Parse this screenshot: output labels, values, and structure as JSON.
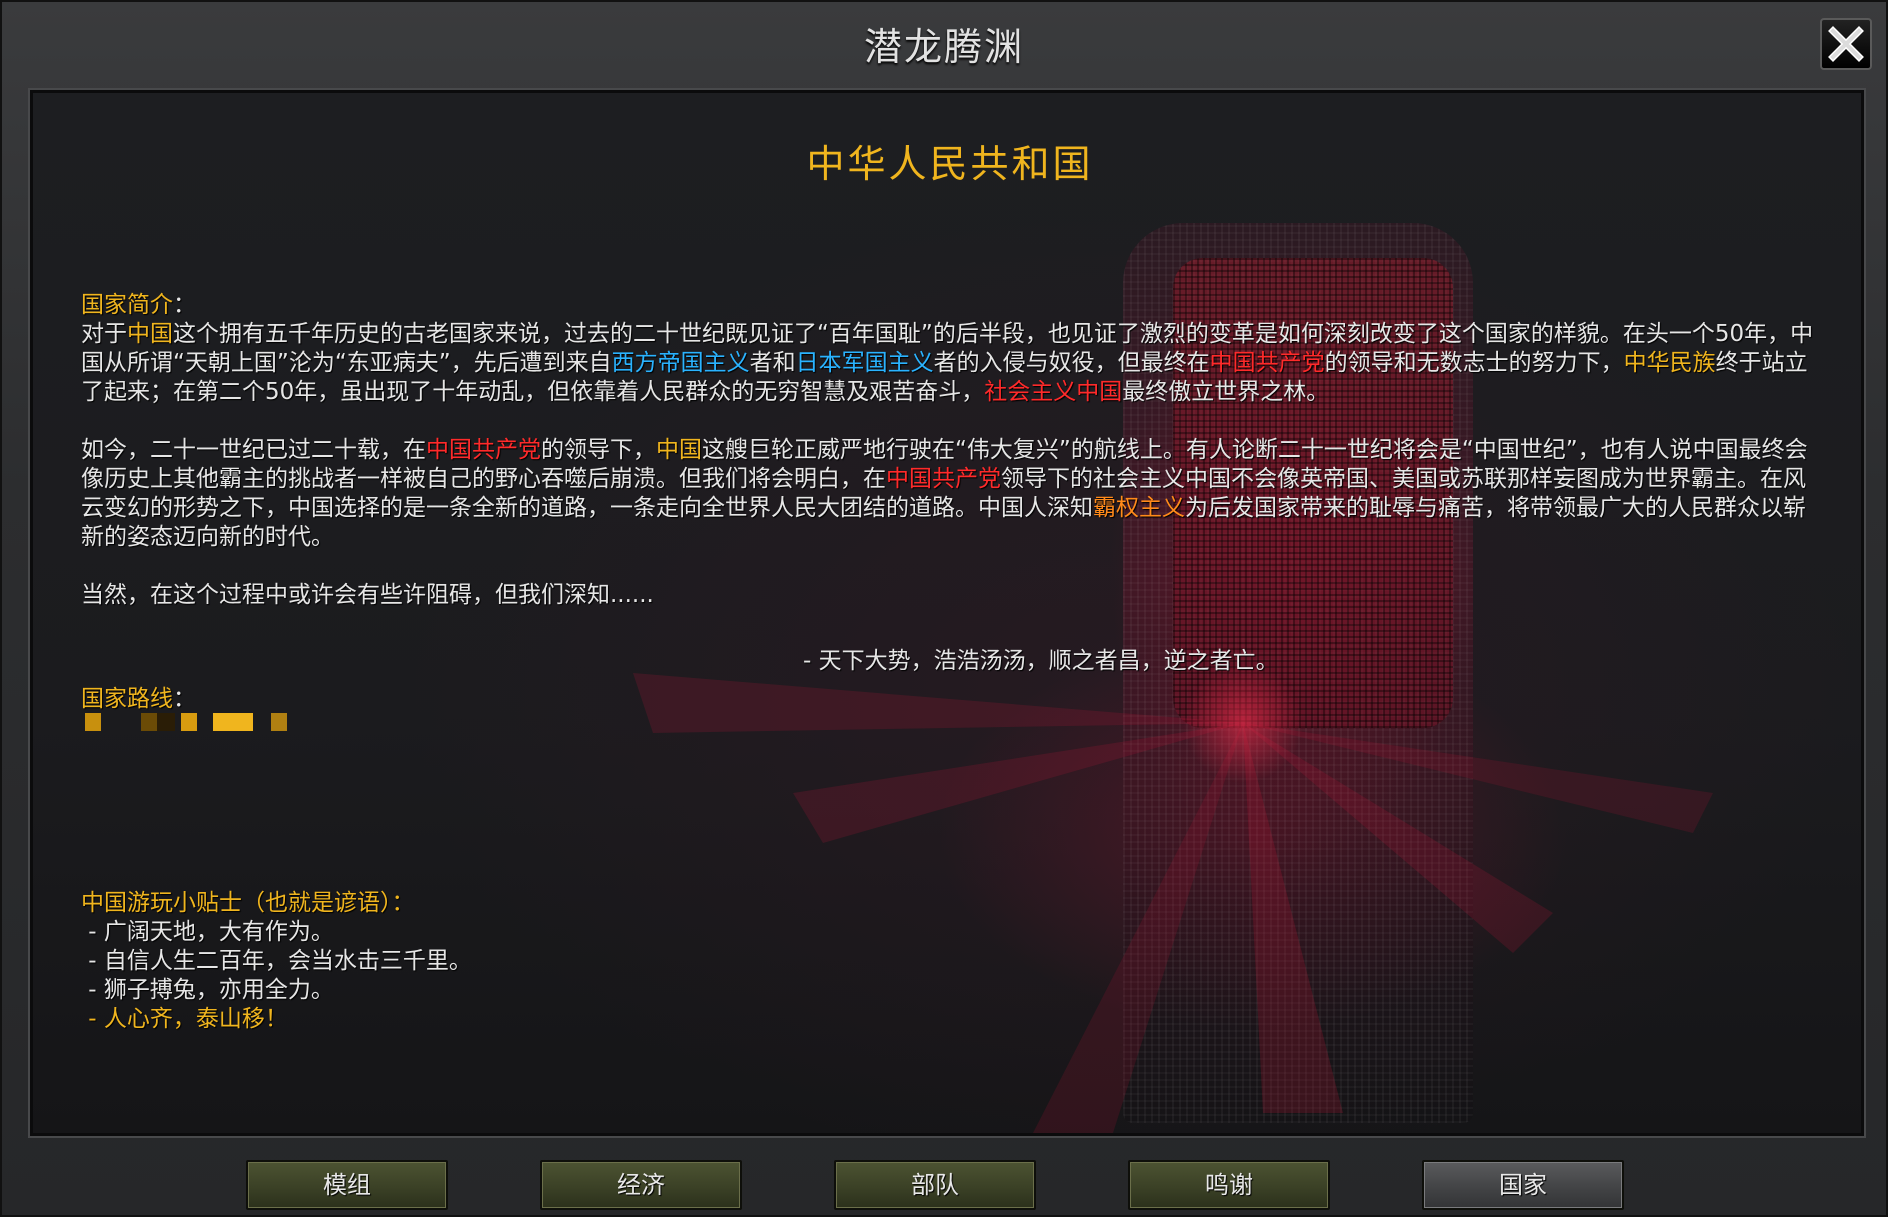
{
  "window": {
    "title": "潜龙腾渊",
    "close_label": "close"
  },
  "country": {
    "name": "中华人民共和国"
  },
  "intro": {
    "title": "国家简介",
    "colon": "：",
    "p1": [
      {
        "t": "对于",
        "c": "n"
      },
      {
        "t": "中国",
        "c": "gold"
      },
      {
        "t": "这个拥有五千年历史的古老国家来说，过去的二十世纪既见证了“百年国耻”的后半段，也见证了激烈的变革是如何深刻改变了这个国家的样貌。在头一个50年，中国从所谓“天朝上国”沦为“东亚病夫”，先后遭到来自",
        "c": "n"
      },
      {
        "t": "西方帝国主义",
        "c": "blue"
      },
      {
        "t": "者和",
        "c": "n"
      },
      {
        "t": "日本军国主义",
        "c": "blue"
      },
      {
        "t": "者的入侵与奴役，但最终在",
        "c": "n"
      },
      {
        "t": "中国共产党",
        "c": "red"
      },
      {
        "t": "的领导和无数志士的努力下，",
        "c": "n"
      },
      {
        "t": "中华民族",
        "c": "gold"
      },
      {
        "t": "终于站立了起来；在第二个50年，虽出现了十年动乱，但依靠着人民群众的无穷智慧及艰苦奋斗，",
        "c": "n"
      },
      {
        "t": "社会主义中国",
        "c": "red"
      },
      {
        "t": "最终傲立世界之林。",
        "c": "n"
      }
    ],
    "p2": [
      {
        "t": "如今，二十一世纪已过二十载，在",
        "c": "n"
      },
      {
        "t": "中国共产党",
        "c": "red"
      },
      {
        "t": "的领导下，",
        "c": "n"
      },
      {
        "t": "中国",
        "c": "gold"
      },
      {
        "t": "这艘巨轮正威严地行驶在“伟大复兴”的航线上。有人论断二十一世纪将会是“中国世纪”，也有人说中国最终会像历史上其他霸主的挑战者一样被自己的野心吞噬后崩溃。但我们将会明白，在",
        "c": "n"
      },
      {
        "t": "中国共产党",
        "c": "red"
      },
      {
        "t": "领导下的社会主义中国不会像英帝国、美国或苏联那样妄图成为世界霸主。在风云变幻的形势之下，中国选择的是一条全新的道路，一条走向全世界人民大团结的道路。中国人深知",
        "c": "n"
      },
      {
        "t": "霸权主义",
        "c": "orange"
      },
      {
        "t": "为后发国家带来的耻辱与痛苦，将带领最广大的人民群众以崭新的姿态迈向新的时代。",
        "c": "n"
      }
    ],
    "p3": "当然，在这个过程中或许会有些许阻碍，但我们深知......",
    "quote": "- 天下大势，浩浩汤汤，顺之者昌，逆之者亡。"
  },
  "route": {
    "title": "国家路线",
    "colon": "：",
    "swatch_colors": [
      "#c8900e",
      "#6b4b06",
      "#2a1d06",
      "#d89c10",
      "#f0b51e",
      "#b08012"
    ]
  },
  "tips": {
    "title": "中国游玩小贴士（也就是谚语）：",
    "items": [
      {
        "text": " - 广阔天地，大有作为。",
        "highlight": false
      },
      {
        "text": " - 自信人生二百年，会当水击三千里。",
        "highlight": false
      },
      {
        "text": " - 狮子搏兔，亦用全力。",
        "highlight": false
      },
      {
        "text": " - 人心齐，泰山移！",
        "highlight": true
      }
    ]
  },
  "buttons": [
    {
      "label": "模组",
      "style": "green"
    },
    {
      "label": "经济",
      "style": "green"
    },
    {
      "label": "部队",
      "style": "green"
    },
    {
      "label": "鸣谢",
      "style": "green"
    },
    {
      "label": "国家",
      "style": "grey"
    }
  ],
  "colors": {
    "gold": "#f0b51e",
    "red": "#ff2a2a",
    "blue": "#2ab3ff",
    "orange": "#ff8a1a",
    "text": "#e6e6e6"
  }
}
